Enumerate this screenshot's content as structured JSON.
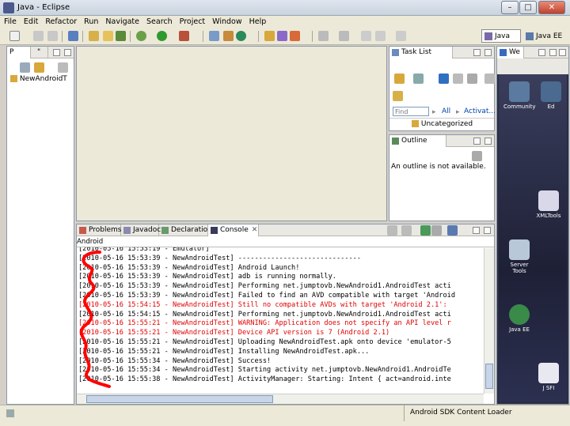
{
  "window": {
    "title": "Java - Eclipse",
    "min_label": "–",
    "max_label": "□",
    "close_label": "✕"
  },
  "menu": [
    "File",
    "Edit",
    "Refactor",
    "Run",
    "Navigate",
    "Search",
    "Project",
    "Window",
    "Help"
  ],
  "perspectives": [
    "Java",
    "Java EE"
  ],
  "left_panel": {
    "tab1": "P",
    "tab2": "\"",
    "tree_item": "NewAndroidT"
  },
  "task_list": {
    "title": "Task List",
    "find_placeholder": "Find",
    "all_label": "All",
    "activate_label": "Activat...",
    "category": "Uncategorized"
  },
  "outline": {
    "title": "Outline",
    "message": "An outline is not available."
  },
  "welcome": {
    "tab": "We",
    "icons": [
      "Community",
      "Ed",
      "XMLTools",
      "Server Tools",
      "Java EE",
      "J SFI"
    ]
  },
  "bottom_tabs": [
    "Problems",
    "Javadoc",
    "Declaration",
    "Console"
  ],
  "console": {
    "header": "Android",
    "lines": [
      {
        "text": "[2010-05-16 15:53:19 - Emulator]",
        "level": "info"
      },
      {
        "text": "[2010-05-16 15:53:39 - NewAndroidTest] ------------------------------",
        "level": "info"
      },
      {
        "text": "[2010-05-16 15:53:39 - NewAndroidTest] Android Launch!",
        "level": "info"
      },
      {
        "text": "[2010-05-16 15:53:39 - NewAndroidTest] adb is running normally.",
        "level": "info"
      },
      {
        "text": "[2010-05-16 15:53:39 - NewAndroidTest] Performing net.jumptovb.NewAndroid1.AndroidTest acti",
        "level": "info"
      },
      {
        "text": "[2010-05-16 15:53:39 - NewAndroidTest] Failed to find an AVD compatible with target 'Android",
        "level": "info"
      },
      {
        "text": "[2010-05-16 15:54:15 - NewAndroidTest] Still no compatible AVDs with target 'Android 2.1':",
        "level": "error"
      },
      {
        "text": "[2010-05-16 15:54:15 - NewAndroidTest] Performing net.jumptovb.NewAndroid1.AndroidTest acti",
        "level": "info"
      },
      {
        "text": "[2010-05-16 15:55:21 - NewAndroidTest] WARNING: Application does not specify an API level r",
        "level": "error"
      },
      {
        "text": "[2010-05-16 15:55:21 - NewAndroidTest] Device API version is 7 (Android 2.1)",
        "level": "error"
      },
      {
        "text": "[2010-05-16 15:55:21 - NewAndroidTest] Uploading NewAndroidTest.apk onto device 'emulator-5",
        "level": "info"
      },
      {
        "text": "[2010-05-16 15:55:21 - NewAndroidTest] Installing NewAndroidTest.apk...",
        "level": "info"
      },
      {
        "text": "[2010-05-16 15:55:34 - NewAndroidTest] Success!",
        "level": "info"
      },
      {
        "text": "[2010-05-16 15:55:34 - NewAndroidTest] Starting activity net.jumptovb.NewAndroid1.AndroidTe",
        "level": "info"
      },
      {
        "text": "[2010-05-16 15:55:38 - NewAndroidTest] ActivityManager: Starting: Intent { act=android.inte",
        "level": "info"
      }
    ]
  },
  "status": {
    "message": "Android SDK Content Loader"
  },
  "colors": {
    "error_text": "#e00000",
    "annotation_stroke": "#ff0000"
  }
}
